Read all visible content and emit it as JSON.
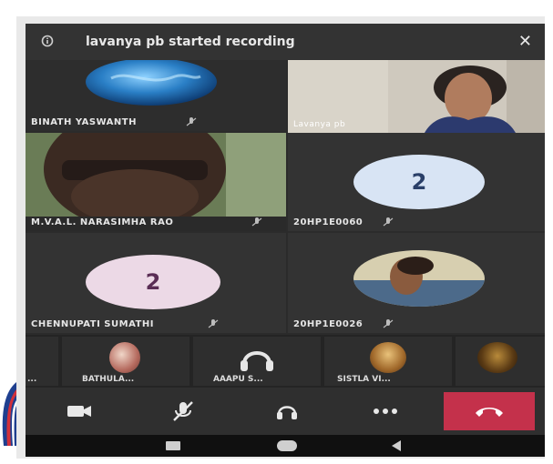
{
  "banner": {
    "text": "lavanya pb started recording",
    "close_symbol": "✕"
  },
  "tiles": {
    "t1_name": "BINATH YASWANTH",
    "t2_name": "Lavanya pb",
    "t3_name": "M.V.A.L. NARASIMHA RAO",
    "t4_name": "20HP1E0060",
    "t4_initial": "2",
    "t5_name": "CHENNUPATI SUMATHI",
    "t5_initial": "2",
    "t6_name": "20HP1E0026"
  },
  "strip": {
    "items": [
      {
        "name": "..."
      },
      {
        "name": "BATHULA..."
      },
      {
        "name": "AAAPU S..."
      },
      {
        "name": "SISTLA VI..."
      },
      {
        "name": ""
      }
    ]
  },
  "colors": {
    "hangup": "#c4314b",
    "tile_bg": "#333333",
    "avatar_blue": "#d8e4f4",
    "avatar_pink": "#ecd9e6"
  },
  "icons": {
    "info": "info-icon",
    "close": "close-icon",
    "video": "video-off-icon",
    "mic": "mic-off-icon",
    "speaker": "speaker-icon",
    "more": "more-icon",
    "hangup": "hangup-icon"
  }
}
